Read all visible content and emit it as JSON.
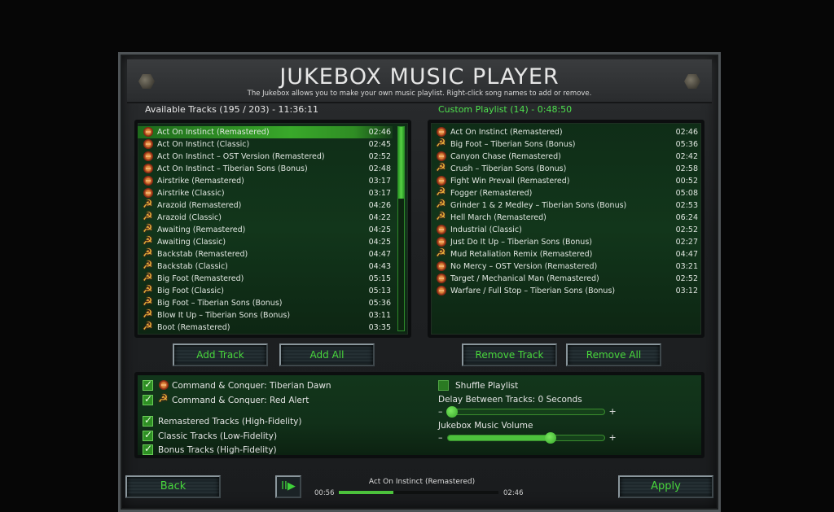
{
  "header": {
    "title": "JUKEBOX MUSIC PLAYER",
    "subtitle": "The Jukebox allows you to make your own music playlist. Right-click song names to add or remove."
  },
  "available": {
    "label": "Available Tracks (195 / 203) - 11:36:11",
    "scroll_position": 0,
    "tracks": [
      {
        "name": "Act On Instinct (Remastered)",
        "time": "02:46",
        "faction": "gdi",
        "selected": true
      },
      {
        "name": "Act On Instinct (Classic)",
        "time": "02:45",
        "faction": "gdi"
      },
      {
        "name": "Act On Instinct – OST Version (Remastered)",
        "time": "02:52",
        "faction": "gdi"
      },
      {
        "name": "Act On Instinct – Tiberian Sons (Bonus)",
        "time": "02:48",
        "faction": "gdi"
      },
      {
        "name": "Airstrike (Remastered)",
        "time": "03:17",
        "faction": "gdi"
      },
      {
        "name": "Airstrike (Classic)",
        "time": "03:17",
        "faction": "gdi"
      },
      {
        "name": "Arazoid (Remastered)",
        "time": "04:26",
        "faction": "soviet"
      },
      {
        "name": "Arazoid (Classic)",
        "time": "04:22",
        "faction": "soviet"
      },
      {
        "name": "Awaiting (Remastered)",
        "time": "04:25",
        "faction": "soviet"
      },
      {
        "name": "Awaiting (Classic)",
        "time": "04:25",
        "faction": "soviet"
      },
      {
        "name": "Backstab (Remastered)",
        "time": "04:47",
        "faction": "soviet"
      },
      {
        "name": "Backstab (Classic)",
        "time": "04:43",
        "faction": "soviet"
      },
      {
        "name": "Big Foot (Remastered)",
        "time": "05:15",
        "faction": "soviet"
      },
      {
        "name": "Big Foot (Classic)",
        "time": "05:13",
        "faction": "soviet"
      },
      {
        "name": "Big Foot – Tiberian Sons (Bonus)",
        "time": "05:36",
        "faction": "soviet"
      },
      {
        "name": "Blow It Up – Tiberian Sons (Bonus)",
        "time": "03:11",
        "faction": "soviet"
      },
      {
        "name": "Boot (Remastered)",
        "time": "03:35",
        "faction": "soviet"
      }
    ]
  },
  "playlist": {
    "label": "Custom Playlist (14) - 0:48:50",
    "tracks": [
      {
        "name": "Act On Instinct (Remastered)",
        "time": "02:46",
        "faction": "gdi"
      },
      {
        "name": "Big Foot – Tiberian Sons (Bonus)",
        "time": "05:36",
        "faction": "soviet"
      },
      {
        "name": "Canyon Chase (Remastered)",
        "time": "02:42",
        "faction": "gdi"
      },
      {
        "name": "Crush – Tiberian Sons (Bonus)",
        "time": "02:58",
        "faction": "soviet"
      },
      {
        "name": "Fight Win Prevail (Remastered)",
        "time": "00:52",
        "faction": "gdi"
      },
      {
        "name": "Fogger (Remastered)",
        "time": "05:08",
        "faction": "soviet"
      },
      {
        "name": "Grinder 1 & 2 Medley – Tiberian Sons (Bonus)",
        "time": "02:53",
        "faction": "soviet"
      },
      {
        "name": "Hell March (Remastered)",
        "time": "06:24",
        "faction": "soviet"
      },
      {
        "name": "Industrial (Classic)",
        "time": "02:52",
        "faction": "gdi"
      },
      {
        "name": "Just Do It Up – Tiberian Sons (Bonus)",
        "time": "02:27",
        "faction": "gdi"
      },
      {
        "name": "Mud Retaliation Remix (Remastered)",
        "time": "04:47",
        "faction": "soviet"
      },
      {
        "name": "No Mercy – OST Version (Remastered)",
        "time": "03:21",
        "faction": "gdi"
      },
      {
        "name": "Target / Mechanical Man (Remastered)",
        "time": "02:52",
        "faction": "gdi"
      },
      {
        "name": "Warfare / Full Stop – Tiberian Sons (Bonus)",
        "time": "03:12",
        "faction": "gdi"
      }
    ]
  },
  "buttons": {
    "add_track": "Add Track",
    "add_all": "Add All",
    "remove_track": "Remove Track",
    "remove_all": "Remove All",
    "back": "Back",
    "apply": "Apply",
    "play_pause": "II▶"
  },
  "filters": {
    "games": [
      {
        "label": "Command & Conquer: Tiberian Dawn",
        "faction": "gdi",
        "checked": true
      },
      {
        "label": "Command & Conquer: Red Alert",
        "faction": "soviet",
        "checked": true
      }
    ],
    "types": [
      {
        "label": "Remastered Tracks (High-Fidelity)",
        "checked": true
      },
      {
        "label": "Classic Tracks (Low-Fidelity)",
        "checked": true
      },
      {
        "label": "Bonus Tracks (High-Fidelity)",
        "checked": true
      }
    ]
  },
  "settings": {
    "shuffle_label": "Shuffle Playlist",
    "shuffle_checked": false,
    "delay_label": "Delay Between Tracks: 0 Seconds",
    "delay_value": 0.0,
    "volume_label": "Jukebox Music Volume",
    "volume_value": 0.66,
    "minus": "–",
    "plus": "+"
  },
  "now_playing": {
    "title": "Act On Instinct (Remastered)",
    "elapsed": "00:56",
    "duration": "02:46",
    "progress": 0.34
  },
  "colors": {
    "accent_green": "#4cc23c",
    "playlist_header": "#4ee04e",
    "button_text": "#48d63c"
  }
}
